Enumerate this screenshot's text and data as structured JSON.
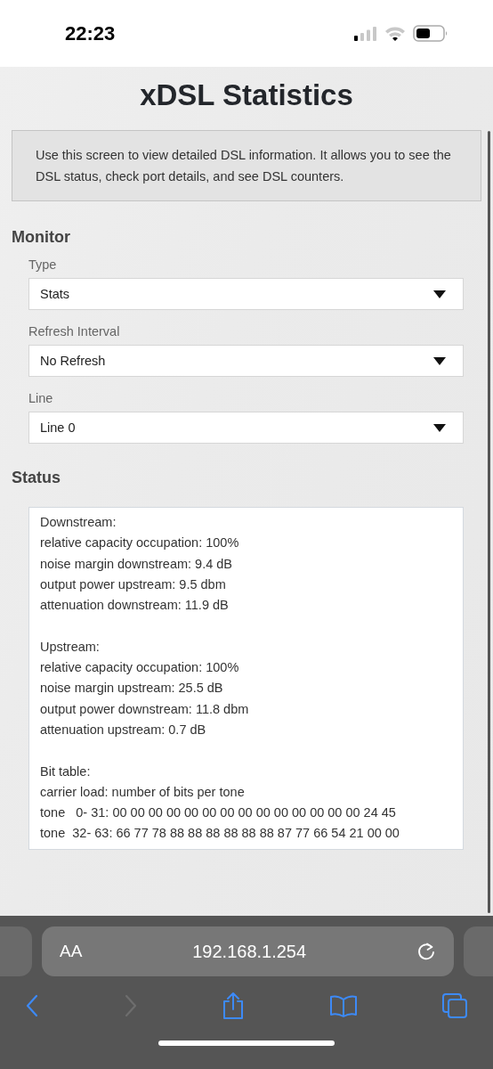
{
  "status_bar": {
    "time": "22:23"
  },
  "page": {
    "title": "xDSL Statistics",
    "info": "Use this screen to view detailed DSL information. It allows you to see the DSL status, check port details, and see DSL counters."
  },
  "monitor": {
    "heading": "Monitor",
    "fields": [
      {
        "label": "Type",
        "value": "Stats"
      },
      {
        "label": "Refresh Interval",
        "value": "No Refresh"
      },
      {
        "label": "Line",
        "value": "Line 0"
      }
    ]
  },
  "status": {
    "heading": "Status",
    "sections": [
      {
        "lines": [
          "Downstream:",
          "relative capacity occupation: 100%",
          "noise margin downstream: 9.4 dB",
          "output power upstream: 9.5 dbm",
          "attenuation downstream: 11.9 dB"
        ]
      },
      {
        "lines": [
          "Upstream:",
          "relative capacity occupation: 100%",
          "noise margin upstream: 25.5 dB",
          "output power downstream: 11.8 dbm",
          "attenuation upstream: 0.7 dB"
        ]
      },
      {
        "lines": [
          "Bit table:",
          "carrier load: number of bits per tone",
          "tone   0- 31: 00 00 00 00 00 00 00 00 00 00 00 00 00 00 24 45",
          "tone  32- 63: 66 77 78 88 88 88 88 88 88 87 77 66 54 21 00 00"
        ]
      }
    ]
  },
  "browser": {
    "text_size": "AA",
    "url": "192.168.1.254",
    "toolbar": [
      {
        "kind": "back",
        "disabled": false
      },
      {
        "kind": "forward",
        "disabled": true
      },
      {
        "kind": "share",
        "disabled": false
      },
      {
        "kind": "bookmarks",
        "disabled": false
      },
      {
        "kind": "tabs",
        "disabled": false
      }
    ]
  }
}
